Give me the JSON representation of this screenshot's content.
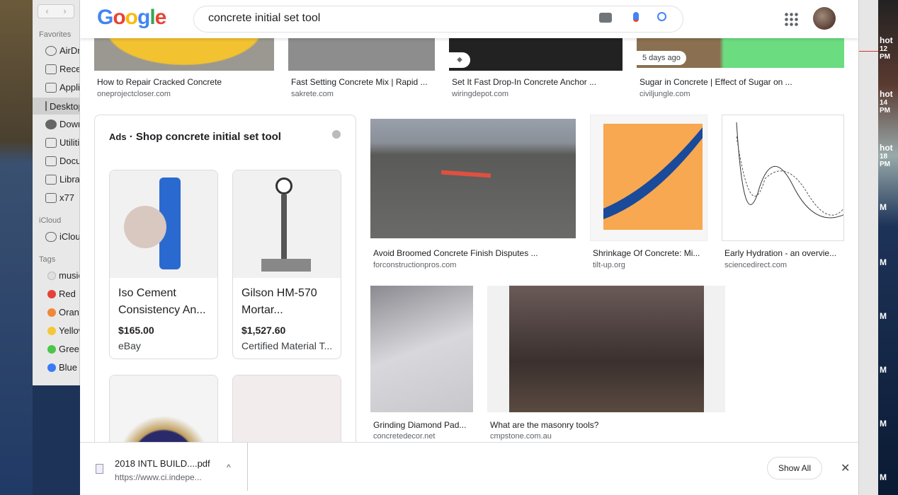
{
  "finder": {
    "sections": [
      {
        "header": "Favorites",
        "items": [
          "AirDrop",
          "Recents",
          "Applications",
          "Desktop",
          "Downloads",
          "Utilities",
          "Documents",
          "Library",
          "x77"
        ]
      },
      {
        "header": "iCloud",
        "items": [
          "iCloud Drive"
        ]
      },
      {
        "header": "Tags",
        "items": [
          "music",
          "Red",
          "Orange",
          "Yellow",
          "Green",
          "Blue"
        ]
      }
    ],
    "tag_colors": [
      "#d0d0d0",
      "#e5403a",
      "#f0883a",
      "#f5c63a",
      "#4cc64a",
      "#3a7af5"
    ]
  },
  "google": {
    "logo": "Google",
    "query": "concrete initial set tool"
  },
  "top_results": [
    {
      "title": "How to Repair Cracked Concrete",
      "source": "oneprojectcloser.com"
    },
    {
      "title": "Fast Setting Concrete Mix | Rapid ...",
      "source": "sakrete.com"
    },
    {
      "title": "Set It Fast Drop-In Concrete Anchor ...",
      "source": "wiringdepot.com"
    },
    {
      "title": "Sugar in Concrete | Effect of Sugar on ...",
      "source": "civiljungle.com",
      "badge": "5 days ago"
    }
  ],
  "ads": {
    "label": "Ads",
    "title": "Shop concrete initial set tool",
    "products": [
      {
        "name": "Iso Cement Consistency An...",
        "price": "$165.00",
        "store": "eBay"
      },
      {
        "name": "Gilson HM-570 Mortar...",
        "price": "$1,527.60",
        "store": "Certified Material T..."
      }
    ]
  },
  "results": [
    {
      "title": "Avoid Broomed Concrete Finish Disputes ...",
      "source": "forconstructionpros.com"
    },
    {
      "title": "Shrinkage Of Concrete: Mi...",
      "source": "tilt-up.org"
    },
    {
      "title": "Early Hydration - an overvie...",
      "source": "sciencedirect.com"
    },
    {
      "title": "Grinding Diamond Pad...",
      "source": "concretedecor.net"
    },
    {
      "title": "What are the masonry tools?",
      "source": "cmpstone.com.au"
    }
  ],
  "download": {
    "filename": "2018 INTL BUILD....pdf",
    "url": "https://www.ci.indepe...",
    "show_all": "Show All"
  },
  "desktop_labels": [
    "hot",
    "12 PM",
    "hot",
    "14 PM",
    "hot",
    "18 PM",
    "M",
    "M",
    "M",
    "M",
    "M",
    "M"
  ]
}
